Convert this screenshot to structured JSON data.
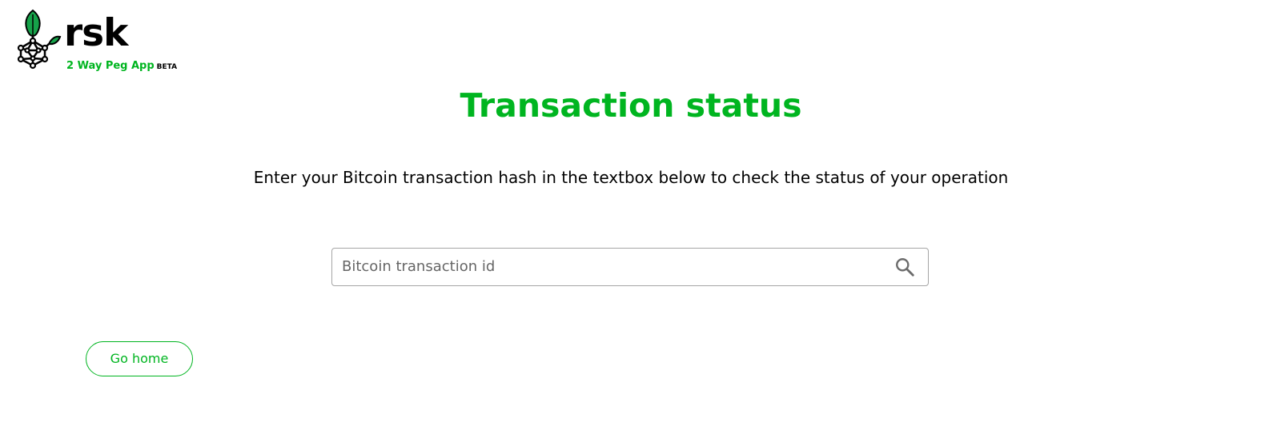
{
  "brand": {
    "wordmark": "rsk",
    "app_name": "2 Way Peg App",
    "badge": "BETA"
  },
  "page": {
    "title": "Transaction status",
    "description": "Enter your Bitcoin transaction hash in the textbox below to check the status of your operation"
  },
  "search": {
    "placeholder": "Bitcoin transaction id",
    "value": "",
    "icon": "search-icon"
  },
  "actions": {
    "home_label": "Go home"
  },
  "colors": {
    "accent": "#00b520",
    "text": "#000000",
    "border": "#a5a5a5",
    "placeholder": "#666666"
  }
}
